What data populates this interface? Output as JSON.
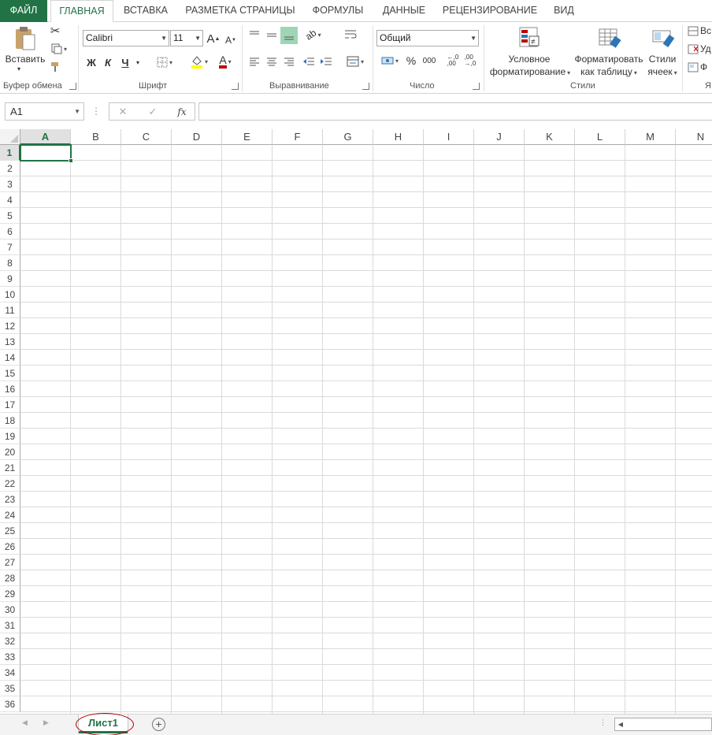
{
  "tabs": [
    {
      "label": "ФАЙЛ"
    },
    {
      "label": "ГЛАВНАЯ"
    },
    {
      "label": "ВСТАВКА"
    },
    {
      "label": "РАЗМЕТКА СТРАНИЦЫ"
    },
    {
      "label": "ФОРМУЛЫ"
    },
    {
      "label": "ДАННЫЕ"
    },
    {
      "label": "РЕЦЕНЗИРОВАНИЕ"
    },
    {
      "label": "ВИД"
    }
  ],
  "ribbon": {
    "clipboard": {
      "paste_label": "Вставить",
      "group_label": "Буфер обмена"
    },
    "font": {
      "font_name": "Calibri",
      "font_size": "11",
      "bold": "Ж",
      "italic": "К",
      "underline": "Ч",
      "grow": "A",
      "shrink": "A",
      "font_color_letter": "A",
      "group_label": "Шрифт"
    },
    "alignment": {
      "group_label": "Выравнивание"
    },
    "number": {
      "format": "Общий",
      "percent": "%",
      "thousands": "000",
      "group_label": "Число"
    },
    "styles": {
      "conditional_line1": "Условное",
      "conditional_line2": "форматирование",
      "format_table_line1": "Форматировать",
      "format_table_line2": "как таблицу",
      "cell_styles_line1": "Стили",
      "cell_styles_line2": "ячеек",
      "group_label": "Стили"
    },
    "cells": {
      "group_label": "Я",
      "insert_short": "Вс",
      "delete_short": "Уд",
      "format_short": "Ф"
    }
  },
  "formula_bar": {
    "name_box": "A1",
    "fx": "fx",
    "cancel": "✕",
    "enter": "✓",
    "value": ""
  },
  "grid": {
    "columns": [
      "A",
      "B",
      "C",
      "D",
      "E",
      "F",
      "G",
      "H",
      "I",
      "J",
      "K",
      "L",
      "M",
      "N"
    ],
    "rows": [
      "1",
      "2",
      "3",
      "4",
      "5",
      "6",
      "7",
      "8",
      "9",
      "10",
      "11",
      "12",
      "13",
      "14",
      "15",
      "16",
      "17",
      "18",
      "19",
      "20",
      "21",
      "22",
      "23",
      "24",
      "25",
      "26",
      "27",
      "28",
      "29",
      "30",
      "31",
      "32",
      "33",
      "34",
      "35",
      "36"
    ],
    "selected_cell": "A1"
  },
  "sheets": [
    {
      "name": "Лист1"
    }
  ],
  "colors": {
    "accent": "#217346",
    "annotation": "#b00000"
  }
}
